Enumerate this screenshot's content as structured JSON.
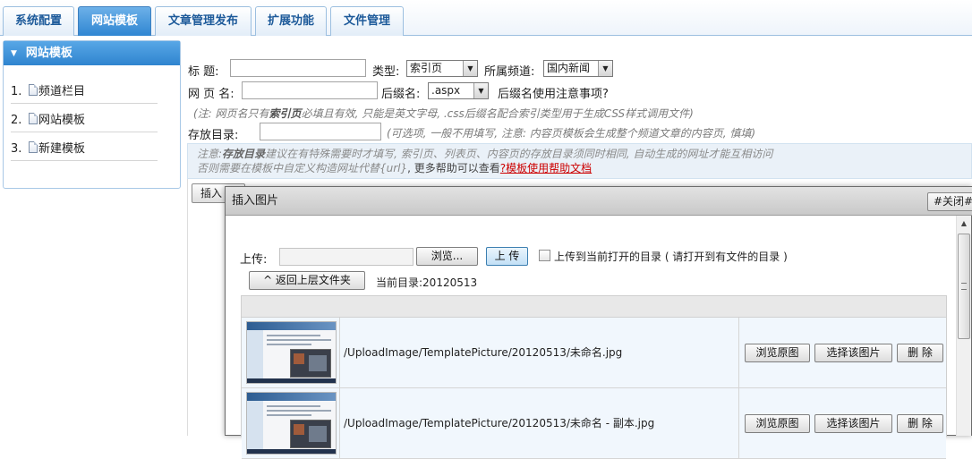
{
  "tabs": [
    {
      "label": "系统配置",
      "active": false
    },
    {
      "label": "网站模板",
      "active": true
    },
    {
      "label": "文章管理发布",
      "active": false
    },
    {
      "label": "扩展功能",
      "active": false
    },
    {
      "label": "文件管理",
      "active": false
    }
  ],
  "sidebar": {
    "title": "网站模板",
    "items": [
      {
        "num": "1.",
        "label": "频道栏目"
      },
      {
        "num": "2.",
        "label": "网站模板"
      },
      {
        "num": "3.",
        "label": "新建模板"
      }
    ]
  },
  "form": {
    "title_label": "标  题:",
    "title_value": "",
    "type_label": "类型:",
    "type_value": "索引页",
    "channel_label": "所属频道:",
    "channel_value": "国内新闻",
    "pagename_label": "网 页 名:",
    "pagename_value": "",
    "suffix_label": "后缀名:",
    "suffix_value": ".aspx",
    "suffix_note": "后缀名使用注意事项?",
    "hint1_pre": "(注: 网页名只有",
    "hint1_bold": "索引页",
    "hint1_post": "必填且有效, 只能是英文字母, .css后缀名配合索引类型用于生成CSS样式调用文件)",
    "dir_label": "存放目录:",
    "dir_value": "",
    "dir_hint": "(可选项, 一般不用填写, 注意: 内容页模板会生成整个频道文章的内容页, 慎填)"
  },
  "notice": {
    "line1_pre": "注意:",
    "line1_bold": "存放目录",
    "line1_post": "建议在有特殊需要时才填写, 索引页、列表页、内容页的存放目录须同时相同, 自动生成的网址才能互相访问",
    "line2_pre": "否则需要在模板中自定义构造网址代替{url}",
    "line2_plain": ", 更多帮助可以查看",
    "help_link": "?模板使用帮助文档"
  },
  "insert_button_behind": "插入",
  "dialog": {
    "title": "插入图片",
    "close_label": "#关闭#",
    "upload_label": "上传:",
    "upload_value": "",
    "browse_button": "浏览...",
    "upload_button": "上 传",
    "upload_checkbox_label": "上传到当前打开的目录 ( 请打开到有文件的目录 )",
    "back_button": "^ 返回上层文件夹",
    "current_dir_label": "当前目录:",
    "current_dir_value": "20120513",
    "files": [
      {
        "path": "/UploadImage/TemplatePicture/20120513/未命名.jpg",
        "view_button": "浏览原图",
        "select_button": "选择该图片",
        "delete_button": "删 除"
      },
      {
        "path": "/UploadImage/TemplatePicture/20120513/未命名 - 副本.jpg",
        "view_button": "浏览原图",
        "select_button": "选择该图片",
        "delete_button": "删 除"
      }
    ]
  },
  "colors": {
    "tab_text": "#1d5a9a",
    "tab_active": "#2f86d2",
    "sidebar_header": "#3d8fd6",
    "hint_text": "#7a7a7a",
    "help_link": "#cc0000",
    "row_bg": "#f1f7fd"
  },
  "icons": {
    "sidebar_toggle": "triangle-down-icon",
    "page": "document-icon"
  }
}
